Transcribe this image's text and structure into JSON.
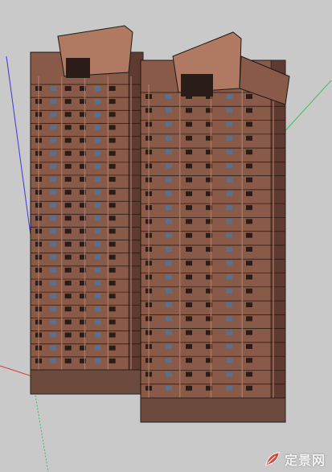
{
  "app": {
    "title": "",
    "viewport_background": "#c9c9c9"
  },
  "model": {
    "description_visible": false,
    "building_color": "#8a5a49",
    "building_shadow": "#5e3a30",
    "building_light": "#b07a62",
    "window_color": "#2a1c19",
    "glass_color": "#5a6f8c",
    "base_color": "#6d4a3e"
  },
  "axes": {
    "red_axis_color": "#d23b3b",
    "green_axis_color": "#3fbf5a",
    "blue_axis_color": "#3a3ad8"
  },
  "watermark": {
    "text": "定景网",
    "icon": "leaf-logo-icon"
  }
}
